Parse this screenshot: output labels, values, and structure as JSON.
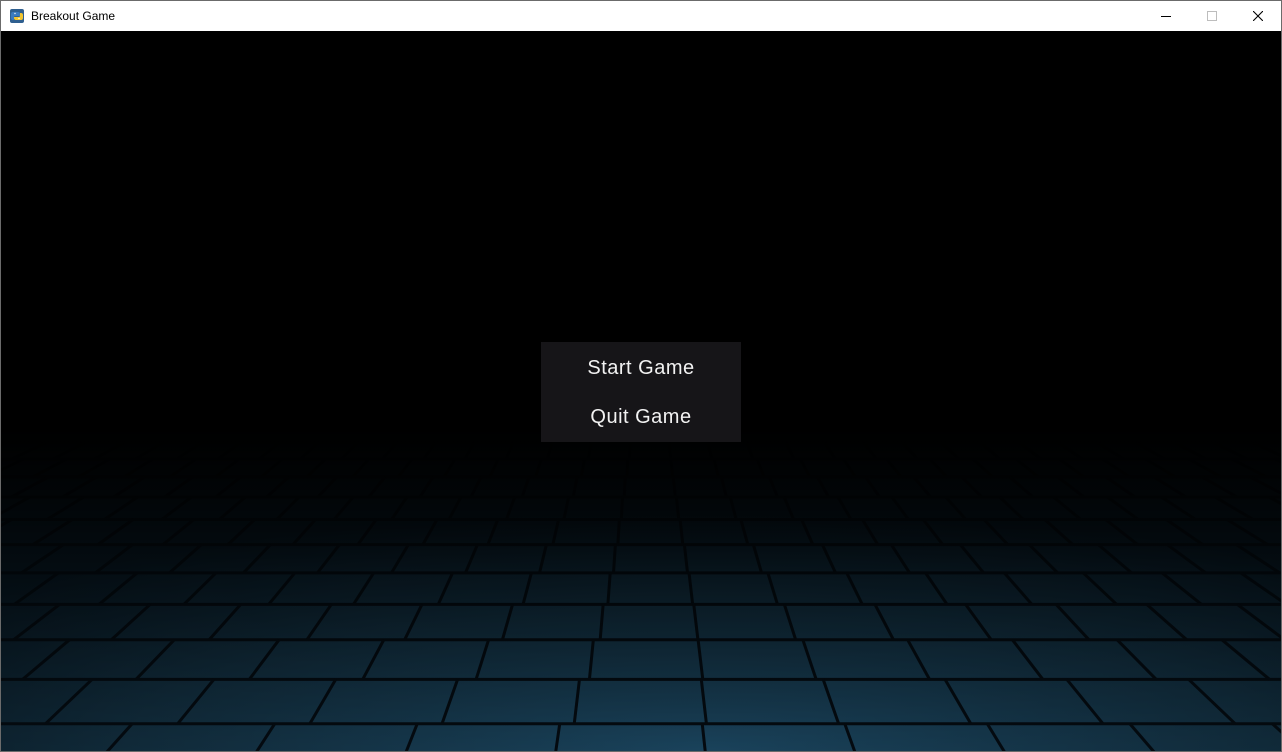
{
  "window": {
    "title": "Breakout Game",
    "app_icon": "python-icon",
    "controls": {
      "minimize": "minimize-icon",
      "maximize": "maximize-icon",
      "close": "close-icon"
    }
  },
  "scene": {
    "background_color": "#000000",
    "floor_color": "#0f2a3a",
    "floor_line_color": "#050d14"
  },
  "main_menu": {
    "background_color": "#161518",
    "text_color": "#f2f2f2",
    "items": [
      {
        "label": "Start Game"
      },
      {
        "label": "Quit Game"
      }
    ]
  }
}
